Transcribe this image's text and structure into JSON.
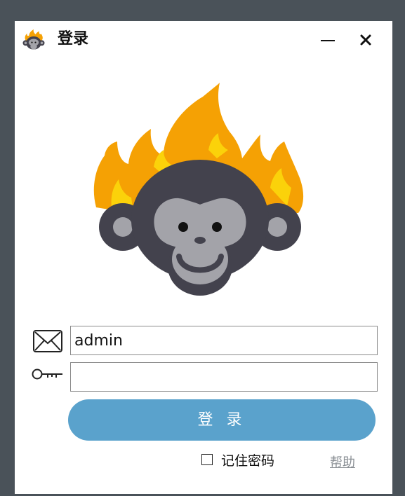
{
  "window": {
    "title": "登录",
    "app_icon": "monkey-flame-logo",
    "minimize_icon": "minimize-icon",
    "close_icon": "close-icon"
  },
  "form": {
    "username_icon": "envelope-icon",
    "username_value": "admin",
    "password_icon": "key-icon",
    "password_value": "",
    "login_label": "登 录",
    "remember_label": "记住密码",
    "remember_checked": false,
    "help_label": "帮助"
  },
  "colors": {
    "background": "#4a5259",
    "window": "#ffffff",
    "login_button": "#5aa2cc",
    "flame_outer": "#f5a104",
    "flame_inner": "#fbd20a",
    "monkey_dark": "#43424d",
    "monkey_face": "#a3a3a9",
    "help_link": "#8a8f94"
  }
}
